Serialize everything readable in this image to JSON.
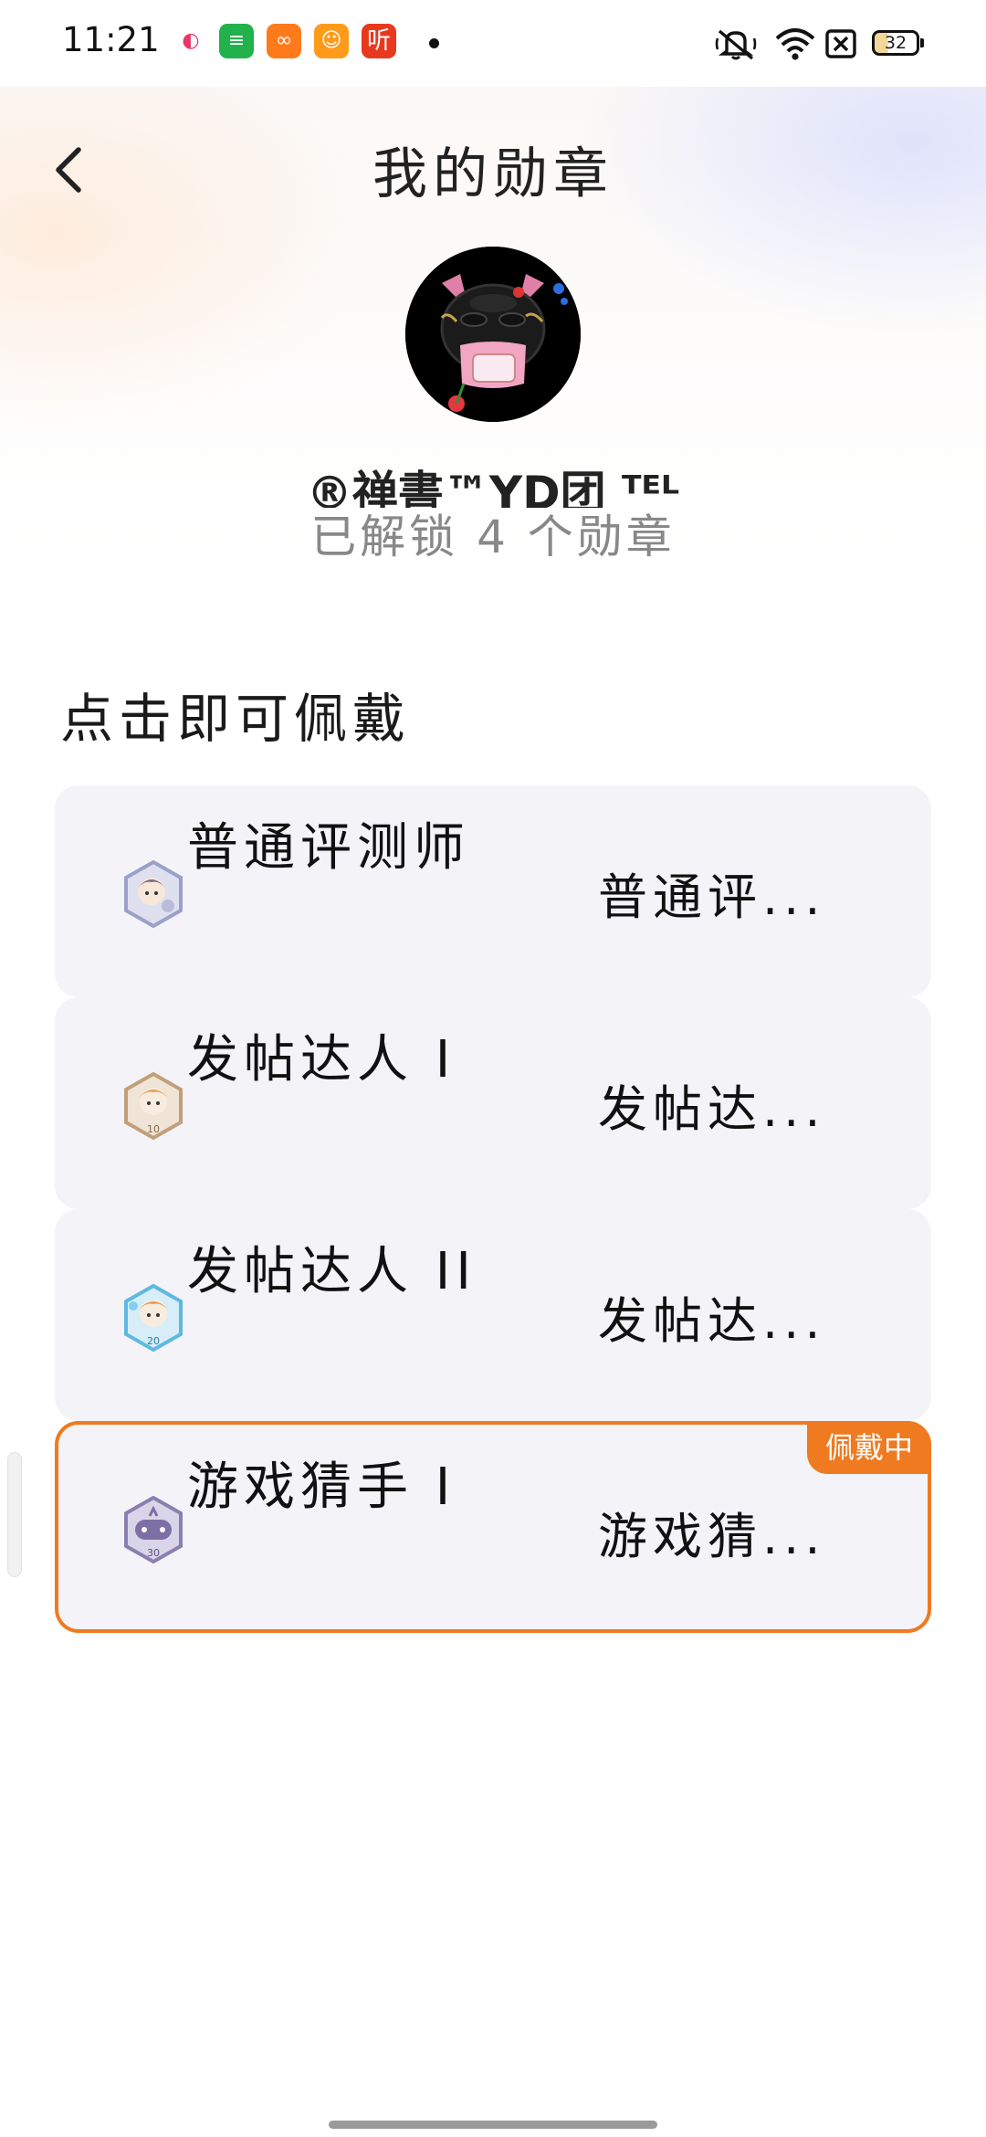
{
  "status_bar": {
    "time": "11:21",
    "notification_apps": [
      {
        "icon": "qq-app-icon",
        "glyph": "◐",
        "color": "#ffffff"
      },
      {
        "icon": "wechat-mini-app-icon",
        "glyph": "≡",
        "color": "#22b24c"
      },
      {
        "icon": "video-app-icon",
        "glyph": "∞",
        "color": "#ff7a1a"
      },
      {
        "icon": "game-app-icon",
        "glyph": "☺",
        "color": "#ff9a1a"
      },
      {
        "icon": "listen-app-icon",
        "glyph": "听",
        "color": "#e8391d"
      }
    ],
    "battery_level": "32"
  },
  "header": {
    "title": "我的勋章"
  },
  "profile": {
    "user_name": "®禅書™YD团 ᵀᴱᴸ",
    "unlock_summary": "已解锁 4 个勋章"
  },
  "section": {
    "title": "点击即可佩戴"
  },
  "badges": [
    {
      "name": "普通评测师",
      "desc": "普通评...",
      "level": "",
      "icon_color": "#9aa0c8",
      "worn": false
    },
    {
      "name": "发帖达人 I",
      "desc": "发帖达...",
      "level": "10",
      "icon_color": "#c0a07a",
      "worn": false
    },
    {
      "name": "发帖达人 II",
      "desc": "发帖达...",
      "level": "20",
      "icon_color": "#5fb8e0",
      "worn": false
    },
    {
      "name": "游戏猜手 I",
      "desc": "游戏猜...",
      "level": "30",
      "icon_color": "#8a7fb0",
      "worn": true
    }
  ],
  "wearing_label": "佩戴中",
  "colors": {
    "accent": "#f07a20",
    "card_bg": "#f4f4f8"
  }
}
